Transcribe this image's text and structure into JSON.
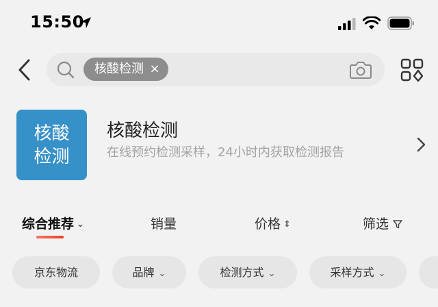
{
  "status_bar": {
    "time": "15:50"
  },
  "search": {
    "query_chip": "核酸检测",
    "chip_close": "×"
  },
  "promo": {
    "logo_line1": "核酸",
    "logo_line2": "检测",
    "title": "核酸检测",
    "subtitle": "在线预约检测采样，24小时内获取检测报告",
    "colors": {
      "logo_bg": "#3791c9"
    }
  },
  "sort": {
    "items": [
      {
        "label": "综合推荐",
        "suffix": "⌄",
        "active": true
      },
      {
        "label": "销量"
      },
      {
        "label": "价格",
        "suffix": "⇕"
      },
      {
        "label": "筛选"
      }
    ],
    "colors": {
      "accent": "#e6432c"
    }
  },
  "filter_chips": [
    {
      "label": "京东物流"
    },
    {
      "label": "品牌",
      "caret": "⌄"
    },
    {
      "label": "检测方式",
      "caret": "⌄"
    },
    {
      "label": "采样方式",
      "caret": "⌄"
    }
  ]
}
